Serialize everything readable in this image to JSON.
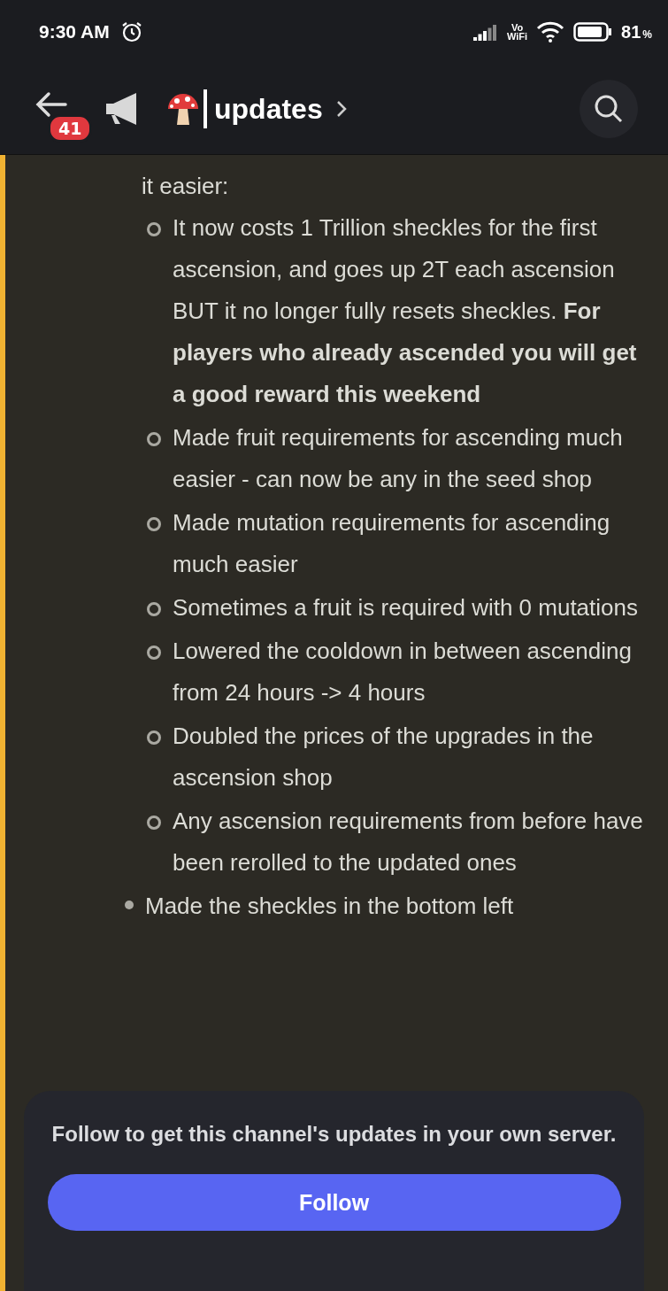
{
  "status_bar": {
    "time": "9:30 AM",
    "vo_label": "Vo",
    "wifi_label": "WiFi",
    "battery": "81",
    "battery_unit": "%"
  },
  "header": {
    "unread_badge": "41",
    "channel_name": "updates"
  },
  "message": {
    "intro": "it easier:",
    "sub_items": [
      {
        "text": "It now costs 1 Trillion sheckles for the first ascension, and goes up 2T each ascension BUT it no longer fully resets sheckles. **For players who already ascended you will get a good reward this weekend**"
      },
      {
        "text": "Made fruit requirements for ascending much easier - can now be any in the seed shop"
      },
      {
        "text": "Made mutation requirements for ascending much easier"
      },
      {
        "text": "Sometimes a fruit is required with 0 mutations"
      },
      {
        "text": "Lowered the cooldown in between ascending from 24 hours -> 4 hours"
      },
      {
        "text": "Doubled the prices of the upgrades in the ascension shop"
      },
      {
        "text": "Any ascension requirements from before have been rerolled to the updated ones"
      }
    ],
    "next_item": "Made the sheckles in the bottom left"
  },
  "follow_panel": {
    "text": "Follow to get this channel's updates in your own server.",
    "button": "Follow"
  }
}
